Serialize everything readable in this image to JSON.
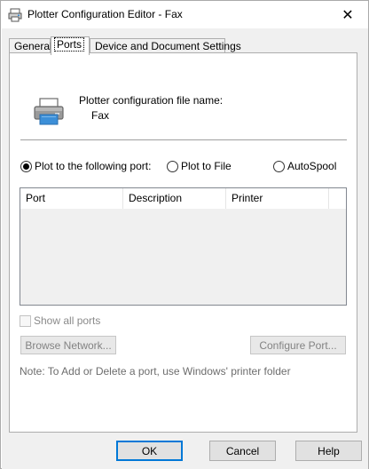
{
  "window": {
    "title": "Plotter Configuration Editor - Fax",
    "close_glyph": "✕"
  },
  "tabs": [
    {
      "label": "General"
    },
    {
      "label": "Ports"
    },
    {
      "label": "Device and Document Settings"
    }
  ],
  "ports_tab": {
    "config_label": "Plotter configuration file name:",
    "config_value": "Fax",
    "radio_plot_port": "Plot to the following port:",
    "radio_plot_file": "Plot to File",
    "radio_autospool": "AutoSpool",
    "selected_radio": "plot_port",
    "columns": [
      "Port",
      "Description",
      "Printer"
    ],
    "show_all_ports": "Show all ports",
    "browse_network": "Browse Network...",
    "configure_port": "Configure Port...",
    "note": "Note: To Add or Delete a port, use Windows' printer folder"
  },
  "footer": {
    "ok": "OK",
    "cancel": "Cancel",
    "help": "Help"
  },
  "colors": {
    "accent": "#0078d7",
    "printer_screen": "#3c8fd8"
  }
}
